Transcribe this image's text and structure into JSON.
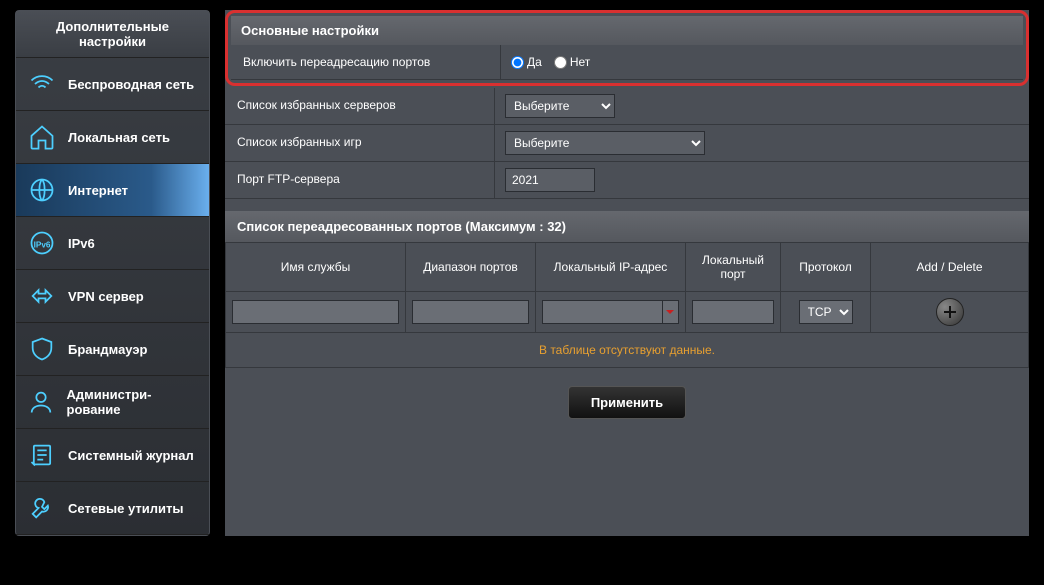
{
  "sidebar": {
    "header": "Дополнительные настройки",
    "items": [
      {
        "label": "Беспроводная сеть"
      },
      {
        "label": "Локальная сеть"
      },
      {
        "label": "Интернет"
      },
      {
        "label": "IPv6"
      },
      {
        "label": "VPN сервер"
      },
      {
        "label": "Брандмауэр"
      },
      {
        "label": "Администри-рование"
      },
      {
        "label": "Системный журнал"
      },
      {
        "label": "Сетевые утилиты"
      }
    ]
  },
  "basic": {
    "header": "Основные настройки",
    "enable_label": "Включить переадресацию портов",
    "yes": "Да",
    "no": "Нет",
    "fav_servers_label": "Список избранных серверов",
    "fav_servers_value": "Выберите",
    "fav_games_label": "Список избранных игр",
    "fav_games_value": "Выберите",
    "ftp_port_label": "Порт FTP-сервера",
    "ftp_port_value": "2021"
  },
  "portlist": {
    "header": "Список переадресованных портов (Максимум : 32)",
    "cols": {
      "service": "Имя службы",
      "range": "Диапазон портов",
      "local_ip": "Локальный IP-адрес",
      "local_port": "Локальный порт",
      "protocol": "Протокол",
      "action": "Add / Delete"
    },
    "protocol_value": "TCP",
    "empty": "В таблице отсутствуют данные."
  },
  "apply": "Применить"
}
